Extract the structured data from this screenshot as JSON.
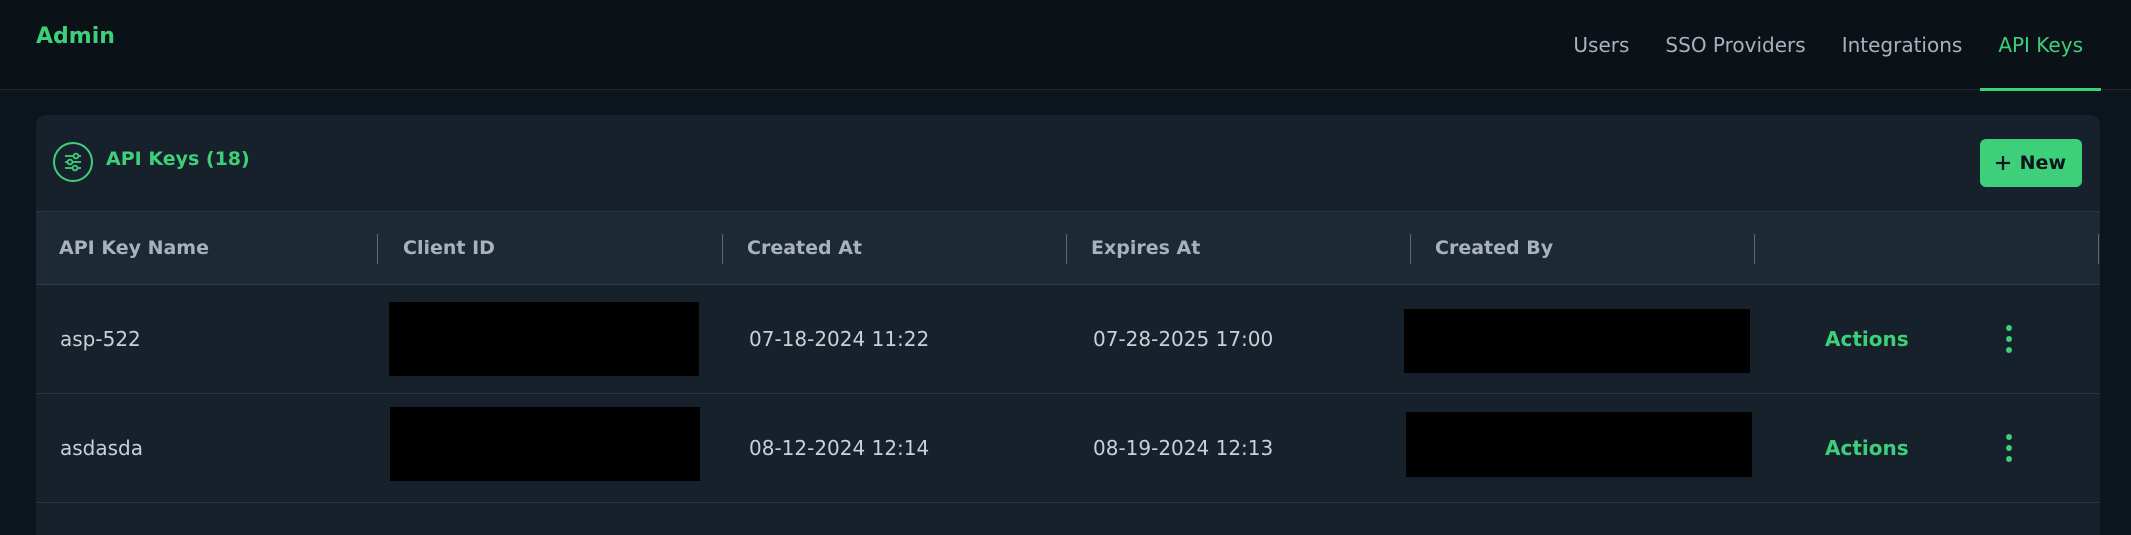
{
  "app": {
    "brand": "Admin"
  },
  "nav": {
    "items": [
      {
        "label": "Users",
        "active": false
      },
      {
        "label": "SSO Providers",
        "active": false
      },
      {
        "label": "Integrations",
        "active": false
      },
      {
        "label": "API Keys",
        "active": true
      }
    ]
  },
  "card": {
    "title": "API Keys (18)",
    "new_button_label": "New"
  },
  "table": {
    "columns": [
      "API Key Name",
      "Client ID",
      "Created At",
      "Expires At",
      "Created By"
    ],
    "rows": [
      {
        "name": "asp-522",
        "created_at": "07-18-2024 11:22",
        "expires_at": "07-28-2025 17:00",
        "actions_label": "Actions"
      },
      {
        "name": "asdasda",
        "created_at": "08-12-2024 12:14",
        "expires_at": "08-19-2024 12:13",
        "actions_label": "Actions"
      }
    ]
  },
  "colors": {
    "accent": "#3ecf7a",
    "background": "#0c151c",
    "card": "#17212b",
    "header_row": "#1d2934"
  }
}
